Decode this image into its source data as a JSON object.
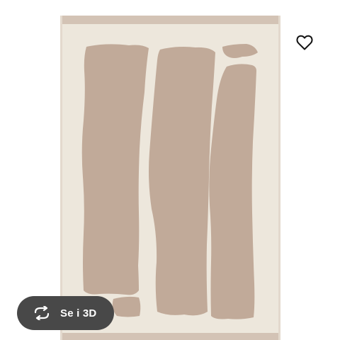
{
  "product": {
    "image_name": "rug-image",
    "colors": {
      "background": "#ffffff",
      "rug_base": "#ede7dc",
      "rug_border": "#d3c3b5",
      "pattern": "#c1aa99"
    }
  },
  "favorite": {
    "icon": "heart-outline-icon",
    "color": "#111111"
  },
  "view_3d": {
    "label": "Se i 3D",
    "icon": "rotate-3d-icon",
    "background": "#484848",
    "text_color": "#ffffff"
  }
}
